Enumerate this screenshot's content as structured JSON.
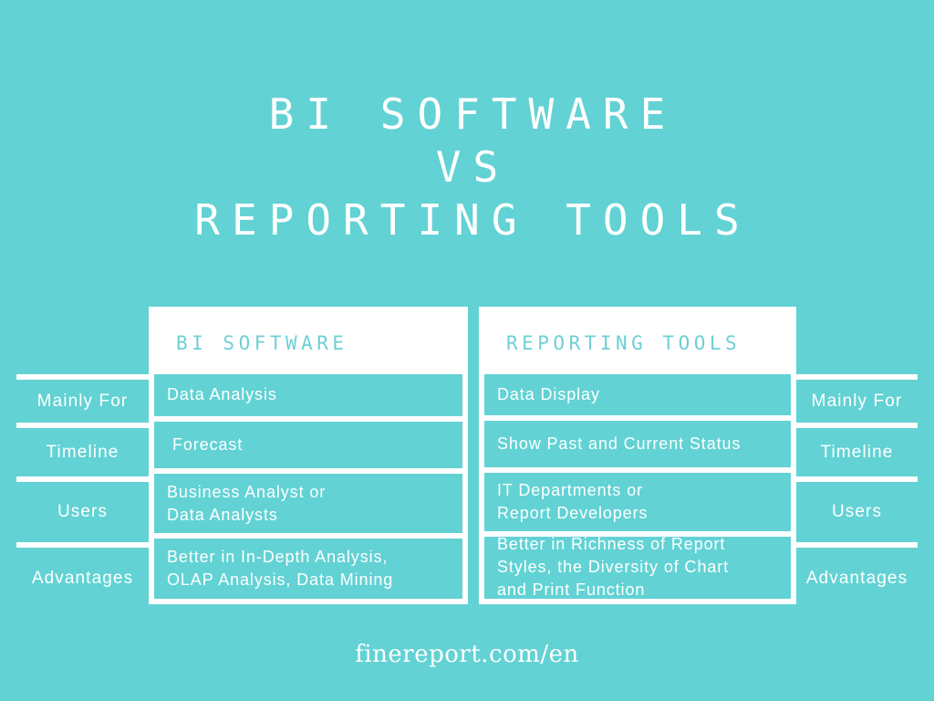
{
  "background_color": "#62d2d4",
  "title": {
    "line1": "BI SOFTWARE",
    "line2": "VS",
    "line3": "REPORTING TOOLS"
  },
  "row_labels": {
    "left": [
      "Mainly For",
      "Timeline",
      "Users",
      "Advantages"
    ],
    "right": [
      "Mainly For",
      "Timeline",
      "Users",
      "Advantages"
    ]
  },
  "columns": [
    {
      "header": "BI SOFTWARE",
      "header_color": "#6ed0d4",
      "cells": [
        {
          "lines": [
            "Data Analysis"
          ]
        },
        {
          "lines": [
            "Forecast"
          ]
        },
        {
          "lines": [
            "Business Analyst or",
            "Data Analysts"
          ]
        },
        {
          "lines": [
            "Better in In-Depth Analysis,",
            "OLAP Analysis, Data Mining"
          ]
        }
      ]
    },
    {
      "header": "REPORTING TOOLS",
      "header_color": "#6ed0d4",
      "cells": [
        {
          "lines": [
            "Data Display"
          ]
        },
        {
          "lines": [
            "Show Past and Current Status"
          ]
        },
        {
          "lines": [
            "IT Departments or",
            "Report Developers"
          ]
        },
        {
          "lines": [
            "Better in Richness of Report",
            "Styles, the Diversity of Chart",
            "and Print Function"
          ]
        }
      ]
    }
  ],
  "footer": {
    "url": "finereport.com/en"
  }
}
